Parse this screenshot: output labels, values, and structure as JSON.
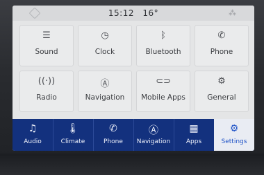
{
  "status": {
    "time": "15:12",
    "temperature": "16°"
  },
  "tiles": [
    {
      "label": "Sound",
      "icon": "equalizer-icon",
      "glyph": "☰"
    },
    {
      "label": "Clock",
      "icon": "clock-icon",
      "glyph": "◷"
    },
    {
      "label": "Bluetooth",
      "icon": "bluetooth-icon",
      "glyph": "ᛒ"
    },
    {
      "label": "Phone",
      "icon": "phone-icon",
      "glyph": "✆"
    },
    {
      "label": "Radio",
      "icon": "radio-signal-icon",
      "glyph": "((·))"
    },
    {
      "label": "Navigation",
      "icon": "navigation-icon",
      "glyph": "Ⓐ"
    },
    {
      "label": "Mobile Apps",
      "icon": "mobile-apps-icon",
      "glyph": "⊂⊃"
    },
    {
      "label": "General",
      "icon": "gears-icon",
      "glyph": "⚙"
    }
  ],
  "pager": {
    "pages": 3,
    "active": 1
  },
  "nav": [
    {
      "label": "Audio",
      "icon": "music-note-icon",
      "glyph": "♫"
    },
    {
      "label": "Climate",
      "icon": "thermometer-icon",
      "glyph": "🌡"
    },
    {
      "label": "Phone",
      "icon": "phone-icon",
      "glyph": "✆"
    },
    {
      "label": "Navigation",
      "icon": "navigation-icon",
      "glyph": "Ⓐ"
    },
    {
      "label": "Apps",
      "icon": "apps-grid-icon",
      "glyph": "▦"
    },
    {
      "label": "Settings",
      "icon": "gears-icon",
      "glyph": "⚙"
    }
  ],
  "colors": {
    "nav_bg": "#13317e",
    "active_text": "#1e52c7"
  }
}
